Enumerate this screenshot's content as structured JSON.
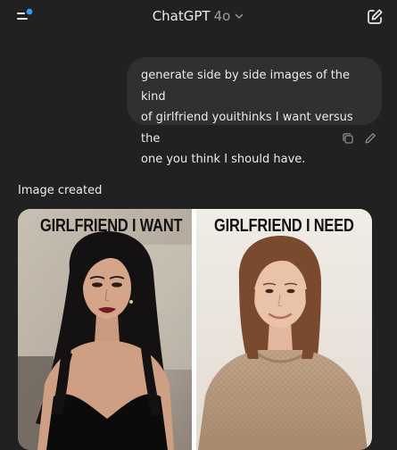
{
  "header": {
    "title": "ChatGPT",
    "model_version": "4o",
    "notification_dot_color": "#339cff"
  },
  "conversation": {
    "user_message": {
      "line1": "generate side by side images of the kind",
      "line2": "of girlfriend youithinks I want versus the",
      "line3": "one you think I should have."
    },
    "assistant": {
      "status": "Image created",
      "image": {
        "left_caption": "GIRLFRIEND I WANT",
        "right_caption": "GIRLFRIEND I NEED"
      }
    }
  },
  "icons": {
    "menu": "menu-icon",
    "new_chat": "compose-icon",
    "model_dropdown": "chevron-down-icon",
    "copy": "copy-icon",
    "edit": "pencil-icon"
  }
}
